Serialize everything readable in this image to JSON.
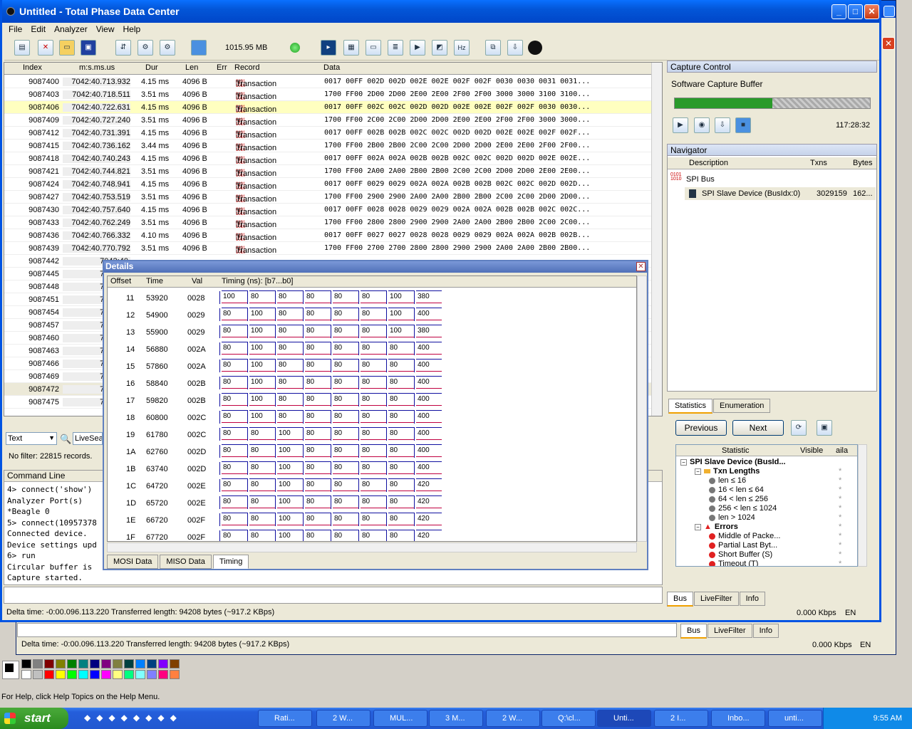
{
  "window": {
    "title": "Untitled - Total Phase Data Center"
  },
  "menu": [
    "File",
    "Edit",
    "Analyzer",
    "View",
    "Help"
  ],
  "toolbar": {
    "memory": "1015.95 MB"
  },
  "grid": {
    "columns": [
      "Index",
      "m:s.ms.us",
      "Dur",
      "Len",
      "Err",
      "Record",
      "Data"
    ],
    "rows": [
      {
        "index": "9087400",
        "ts": "7042:40.713.932",
        "dur": "4.15 ms",
        "len": "4096 B",
        "rec": "Transaction",
        "data": "0017 00FF 002D 002D 002E 002E 002F 002F 0030 0030 0031 0031..."
      },
      {
        "index": "9087403",
        "ts": "7042:40.718.511",
        "dur": "3.51 ms",
        "len": "4096 B",
        "rec": "Transaction",
        "data": "1700 FF00 2D00 2D00 2E00 2E00 2F00 2F00 3000 3000 3100 3100..."
      },
      {
        "index": "9087406",
        "ts": "7042:40.722.631",
        "dur": "4.15 ms",
        "len": "4096 B",
        "rec": "Transaction",
        "data": "0017 00FF 002C 002C 002D 002D 002E 002E 002F 002F 0030 0030..."
      },
      {
        "index": "9087409",
        "ts": "7042:40.727.240",
        "dur": "3.51 ms",
        "len": "4096 B",
        "rec": "Transaction",
        "data": "1700 FF00 2C00 2C00 2D00 2D00 2E00 2E00 2F00 2F00 3000 3000..."
      },
      {
        "index": "9087412",
        "ts": "7042:40.731.391",
        "dur": "4.15 ms",
        "len": "4096 B",
        "rec": "Transaction",
        "data": "0017 00FF 002B 002B 002C 002C 002D 002D 002E 002E 002F 002F..."
      },
      {
        "index": "9087415",
        "ts": "7042:40.736.162",
        "dur": "3.44 ms",
        "len": "4096 B",
        "rec": "Transaction",
        "data": "1700 FF00 2B00 2B00 2C00 2C00 2D00 2D00 2E00 2E00 2F00 2F00..."
      },
      {
        "index": "9087418",
        "ts": "7042:40.740.243",
        "dur": "4.15 ms",
        "len": "4096 B",
        "rec": "Transaction",
        "data": "0017 00FF 002A 002A 002B 002B 002C 002C 002D 002D 002E 002E..."
      },
      {
        "index": "9087421",
        "ts": "7042:40.744.821",
        "dur": "3.51 ms",
        "len": "4096 B",
        "rec": "Transaction",
        "data": "1700 FF00 2A00 2A00 2B00 2B00 2C00 2C00 2D00 2D00 2E00 2E00..."
      },
      {
        "index": "9087424",
        "ts": "7042:40.748.941",
        "dur": "4.15 ms",
        "len": "4096 B",
        "rec": "Transaction",
        "data": "0017 00FF 0029 0029 002A 002A 002B 002B 002C 002C 002D 002D..."
      },
      {
        "index": "9087427",
        "ts": "7042:40.753.519",
        "dur": "3.51 ms",
        "len": "4096 B",
        "rec": "Transaction",
        "data": "1700 FF00 2900 2900 2A00 2A00 2B00 2B00 2C00 2C00 2D00 2D00..."
      },
      {
        "index": "9087430",
        "ts": "7042:40.757.640",
        "dur": "4.15 ms",
        "len": "4096 B",
        "rec": "Transaction",
        "data": "0017 00FF 0028 0028 0029 0029 002A 002A 002B 002B 002C 002C..."
      },
      {
        "index": "9087433",
        "ts": "7042:40.762.249",
        "dur": "3.51 ms",
        "len": "4096 B",
        "rec": "Transaction",
        "data": "1700 FF00 2800 2800 2900 2900 2A00 2A00 2B00 2B00 2C00 2C00..."
      },
      {
        "index": "9087436",
        "ts": "7042:40.766.332",
        "dur": "4.10 ms",
        "len": "4096 B",
        "rec": "Transaction",
        "data": "0017 00FF 0027 0027 0028 0028 0029 0029 002A 002A 002B 002B..."
      },
      {
        "index": "9087439",
        "ts": "7042:40.770.792",
        "dur": "3.51 ms",
        "len": "4096 B",
        "rec": "Transaction",
        "data": "1700 FF00 2700 2700 2800 2800 2900 2900 2A00 2A00 2B00 2B00..."
      },
      {
        "index": "9087442",
        "ts": "7042:40.",
        "dur": "",
        "len": "",
        "rec": "",
        "data": ""
      },
      {
        "index": "9087445",
        "ts": "7042:40.",
        "dur": "",
        "len": "",
        "rec": "",
        "data": ""
      },
      {
        "index": "9087448",
        "ts": "7042:40.",
        "dur": "",
        "len": "",
        "rec": "",
        "data": ""
      },
      {
        "index": "9087451",
        "ts": "7042:40.",
        "dur": "",
        "len": "",
        "rec": "",
        "data": ""
      },
      {
        "index": "9087454",
        "ts": "7042:40.",
        "dur": "",
        "len": "",
        "rec": "",
        "data": ""
      },
      {
        "index": "9087457",
        "ts": "7042:40.",
        "dur": "",
        "len": "",
        "rec": "",
        "data": ""
      },
      {
        "index": "9087460",
        "ts": "7042:40.",
        "dur": "",
        "len": "",
        "rec": "",
        "data": ""
      },
      {
        "index": "9087463",
        "ts": "7042:40.",
        "dur": "",
        "len": "",
        "rec": "",
        "data": ""
      },
      {
        "index": "9087466",
        "ts": "7042:40.",
        "dur": "",
        "len": "",
        "rec": "",
        "data": ""
      },
      {
        "index": "9087469",
        "ts": "7042:40.",
        "dur": "",
        "len": "",
        "rec": "",
        "data": ""
      },
      {
        "index": "9087472",
        "ts": "7042:40.",
        "dur": "",
        "len": "",
        "rec": "",
        "data": ""
      },
      {
        "index": "9087475",
        "ts": "7042:40.",
        "dur": "",
        "len": "",
        "rec": "",
        "data": ""
      }
    ]
  },
  "filter": {
    "mode": "Text",
    "search": "LiveSea",
    "status": "No filter: 22815 records."
  },
  "details": {
    "title": "Details",
    "columns": [
      "Offset",
      "Time",
      "Val",
      "Timing (ns): [b7...b0]"
    ],
    "rows": [
      {
        "off": "11",
        "time": "53920",
        "val": "0028",
        "t": [
          "100",
          "80",
          "80",
          "80",
          "80",
          "80",
          "100",
          "380"
        ]
      },
      {
        "off": "12",
        "time": "54900",
        "val": "0029",
        "t": [
          "80",
          "100",
          "80",
          "80",
          "80",
          "80",
          "100",
          "400"
        ]
      },
      {
        "off": "13",
        "time": "55900",
        "val": "0029",
        "t": [
          "80",
          "100",
          "80",
          "80",
          "80",
          "80",
          "100",
          "380"
        ]
      },
      {
        "off": "14",
        "time": "56880",
        "val": "002A",
        "t": [
          "80",
          "100",
          "80",
          "80",
          "80",
          "80",
          "80",
          "400"
        ]
      },
      {
        "off": "15",
        "time": "57860",
        "val": "002A",
        "t": [
          "80",
          "100",
          "80",
          "80",
          "80",
          "80",
          "80",
          "400"
        ]
      },
      {
        "off": "16",
        "time": "58840",
        "val": "002B",
        "t": [
          "80",
          "100",
          "80",
          "80",
          "80",
          "80",
          "80",
          "400"
        ]
      },
      {
        "off": "17",
        "time": "59820",
        "val": "002B",
        "t": [
          "80",
          "100",
          "80",
          "80",
          "80",
          "80",
          "80",
          "400"
        ]
      },
      {
        "off": "18",
        "time": "60800",
        "val": "002C",
        "t": [
          "80",
          "100",
          "80",
          "80",
          "80",
          "80",
          "80",
          "400"
        ]
      },
      {
        "off": "19",
        "time": "61780",
        "val": "002C",
        "t": [
          "80",
          "80",
          "100",
          "80",
          "80",
          "80",
          "80",
          "400"
        ]
      },
      {
        "off": "1A",
        "time": "62760",
        "val": "002D",
        "t": [
          "80",
          "80",
          "100",
          "80",
          "80",
          "80",
          "80",
          "400"
        ]
      },
      {
        "off": "1B",
        "time": "63740",
        "val": "002D",
        "t": [
          "80",
          "80",
          "100",
          "80",
          "80",
          "80",
          "80",
          "400"
        ]
      },
      {
        "off": "1C",
        "time": "64720",
        "val": "002E",
        "t": [
          "80",
          "80",
          "100",
          "80",
          "80",
          "80",
          "80",
          "420"
        ]
      },
      {
        "off": "1D",
        "time": "65720",
        "val": "002E",
        "t": [
          "80",
          "80",
          "100",
          "80",
          "80",
          "80",
          "80",
          "420"
        ]
      },
      {
        "off": "1E",
        "time": "66720",
        "val": "002F",
        "t": [
          "80",
          "80",
          "100",
          "80",
          "80",
          "80",
          "80",
          "420"
        ]
      },
      {
        "off": "1F",
        "time": "67720",
        "val": "002F",
        "t": [
          "80",
          "80",
          "100",
          "80",
          "80",
          "80",
          "80",
          "420"
        ]
      }
    ],
    "tabs": [
      "MOSI Data",
      "MISO Data",
      "Timing"
    ]
  },
  "capture": {
    "title": "Capture Control",
    "label": "Software Capture Buffer",
    "progress": 0.5,
    "time": "117:28:32"
  },
  "navigator": {
    "title": "Navigator",
    "columns": [
      "Description",
      "Txns",
      "Bytes"
    ],
    "bus": "SPI Bus",
    "device": "SPI Slave Device (BusIdx:0)",
    "txns": "3029159",
    "bytes": "162..."
  },
  "stats": {
    "tabs": [
      "Statistics",
      "Enumeration"
    ],
    "prev": "Previous",
    "next": "Next",
    "columns": [
      "Statistic",
      "Visible",
      "aila"
    ],
    "items": [
      {
        "label": "SPI Slave Device (BusId...",
        "indent": 0,
        "kind": "root"
      },
      {
        "label": "Txn Lengths",
        "indent": 1,
        "kind": "group"
      },
      {
        "label": "len ≤ 16",
        "indent": 2,
        "kind": "gray"
      },
      {
        "label": "16 < len ≤ 64",
        "indent": 2,
        "kind": "gray"
      },
      {
        "label": "64 < len ≤ 256",
        "indent": 2,
        "kind": "gray"
      },
      {
        "label": "256 < len ≤ 1024",
        "indent": 2,
        "kind": "gray"
      },
      {
        "label": "len  > 1024",
        "indent": 2,
        "kind": "gray"
      },
      {
        "label": "Errors",
        "indent": 1,
        "kind": "warn"
      },
      {
        "label": "Middle of Packe...",
        "indent": 2,
        "kind": "red"
      },
      {
        "label": "Partial Last Byt...",
        "indent": 2,
        "kind": "red"
      },
      {
        "label": "Short Buffer (S)",
        "indent": 2,
        "kind": "red"
      },
      {
        "label": "Timeout (T)",
        "indent": 2,
        "kind": "red"
      }
    ],
    "visible_mark": "*"
  },
  "bottom_tabs": [
    "Bus",
    "LiveFilter",
    "Info"
  ],
  "command": {
    "title": "Command Line",
    "lines": [
      "4> connect('show')",
      " Analyzer Port(s)",
      "*Beagle   0",
      "5> connect(10957378",
      "Connected device.",
      "Device settings upd",
      "6> run",
      "Circular buffer is",
      "Capture started."
    ]
  },
  "status": {
    "text": "Delta time: -0:00.096.113.220  Transferred length: 94208 bytes (~917.2 KBps)",
    "rate": "0.000 Kbps",
    "lang": "EN"
  },
  "back_status": {
    "text": "Delta time: -0:00.096.113.220  Transferred length: 94208 bytes (~917.2 KBps)",
    "rate": "0.000 Kbps",
    "lang": "EN"
  },
  "help_text": "For Help, click Help Topics on the Help Menu.",
  "taskbar": {
    "start": "start",
    "items": [
      "Rati...",
      "2 W...",
      "MUL...",
      "3 M...",
      "2 W...",
      "Q:\\cl...",
      "Unti...",
      "2 I...",
      "Inbo...",
      "unti..."
    ],
    "clock": "9:55 AM"
  },
  "colors": {
    "highlight": "#ffffc0",
    "title_blue": "#0356d8",
    "progress_green": "#2a9a2a"
  }
}
